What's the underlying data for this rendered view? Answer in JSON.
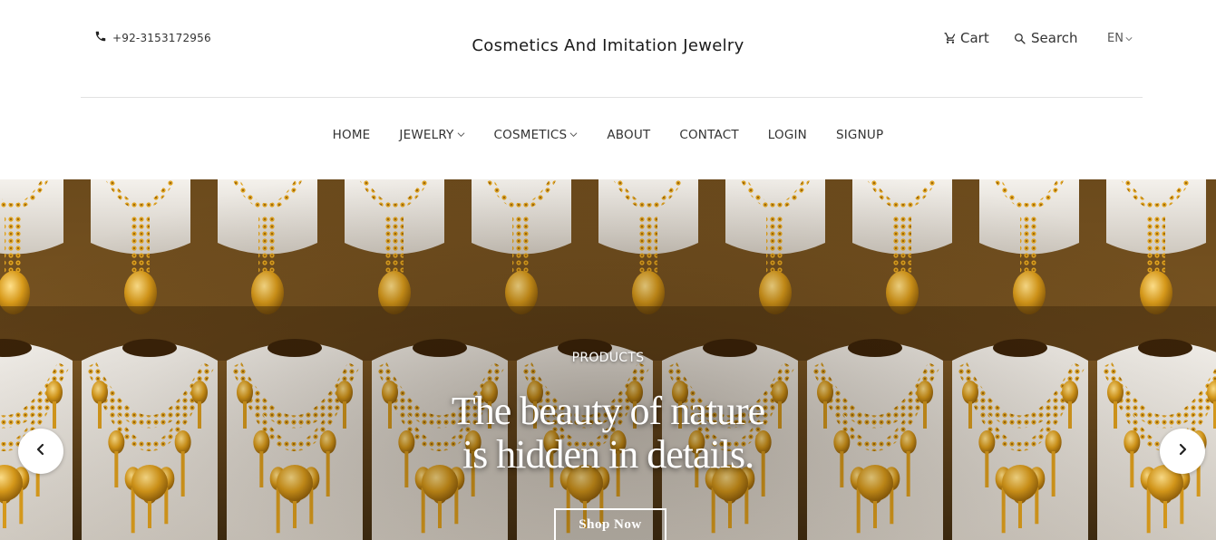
{
  "header": {
    "phone": "+92-3153172956",
    "site_title": "Cosmetics And Imitation Jewelry",
    "cart_label": "Cart",
    "search_label": "Search",
    "language": "EN"
  },
  "nav": {
    "items": [
      {
        "label": "HOME",
        "dropdown": false
      },
      {
        "label": "JEWELRY",
        "dropdown": true
      },
      {
        "label": "COSMETICS",
        "dropdown": true
      },
      {
        "label": "ABOUT",
        "dropdown": false
      },
      {
        "label": "CONTACT",
        "dropdown": false
      },
      {
        "label": "LOGIN",
        "dropdown": false
      },
      {
        "label": "SIGNUP",
        "dropdown": false
      }
    ]
  },
  "hero": {
    "eyebrow": "PRODUCTS",
    "heading_line1": "The beauty of nature",
    "heading_line2": "is hidden in details.",
    "button_label": "Shop Now",
    "prev_icon": "chevron-left-icon",
    "next_icon": "chevron-right-icon"
  },
  "colors": {
    "text_dark": "#1a1a1a",
    "divider": "#e2e2e2",
    "gold": "#d69a16",
    "hero_overlay_text": "#ffffff"
  }
}
